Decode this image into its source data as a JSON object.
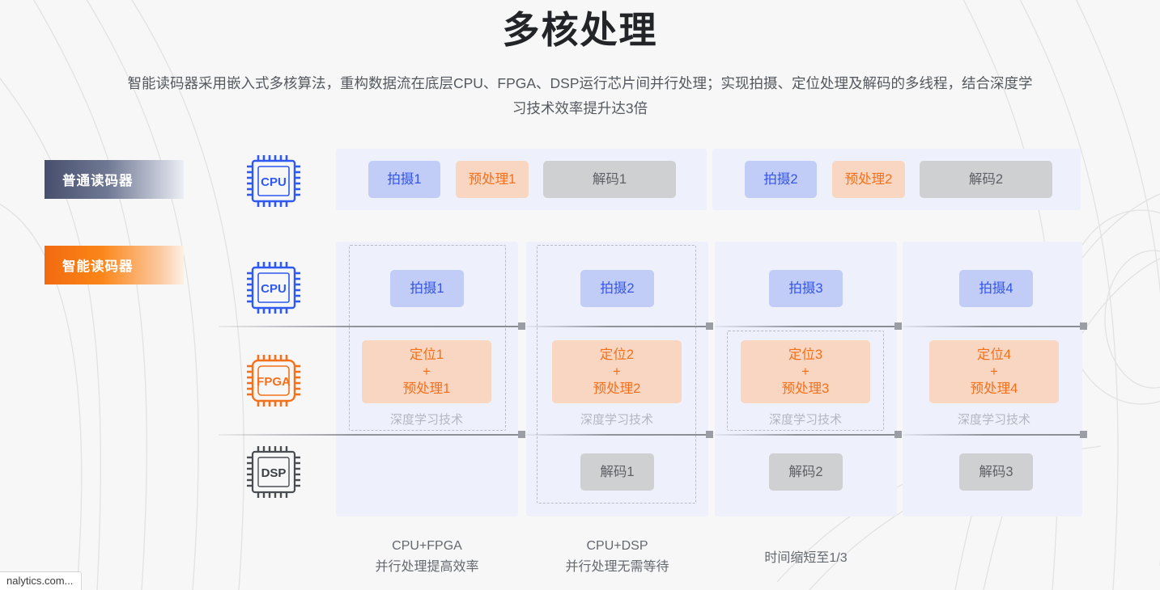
{
  "header": {
    "title": "多核处理",
    "description": "智能读码器采用嵌入式多核算法，重构数据流在底层CPU、FPGA、DSP运行芯片间并行处理；实现拍摄、定位处理及解码的多线程，结合深度学习技术效率提升达3倍"
  },
  "rows": {
    "normal_label": "普通读码器",
    "smart_label": "智能读码器"
  },
  "chips": {
    "cpu_top": "CPU",
    "cpu_bottom": "CPU",
    "fpga": "FPGA",
    "dsp": "DSP"
  },
  "normal_reader": {
    "group1": {
      "capture": "拍摄1",
      "preprocess": "预处理1",
      "decode": "解码1"
    },
    "group2": {
      "capture": "拍摄2",
      "preprocess": "预处理2",
      "decode": "解码2"
    }
  },
  "smart_reader": {
    "cpu": [
      "拍摄1",
      "拍摄2",
      "拍摄3",
      "拍摄4"
    ],
    "fpga": [
      "定位1\n+\n预处理1",
      "定位2\n+\n预处理2",
      "定位3\n+\n预处理3",
      "定位4\n+\n预处理4"
    ],
    "dsp": [
      "",
      "解码1",
      "解码2",
      "解码3"
    ],
    "deep_learning_note": "深度学习技术"
  },
  "captions": [
    "CPU+FPGA\n并行处理提高效率",
    "CPU+DSP\n并行处理无需等待",
    "时间缩短至1/3"
  ],
  "statusbar": {
    "url": "nalytics.com..."
  },
  "colors": {
    "blue_task_bg": "#c2cdf7",
    "blue_task_text": "#3355e8",
    "orange_task_bg": "#f9d6c1",
    "orange_task_text": "#f4701b",
    "gray_task_bg": "#cfd0d2",
    "gray_task_text": "#5e6166",
    "panel_bg": "#eef1fb",
    "cpu_icon": "#2f59f0",
    "fpga_icon": "#f4701b",
    "dsp_icon": "#4a4d52",
    "chip_normal_start": "#474f6e",
    "chip_smart_start": "#f26a10"
  }
}
